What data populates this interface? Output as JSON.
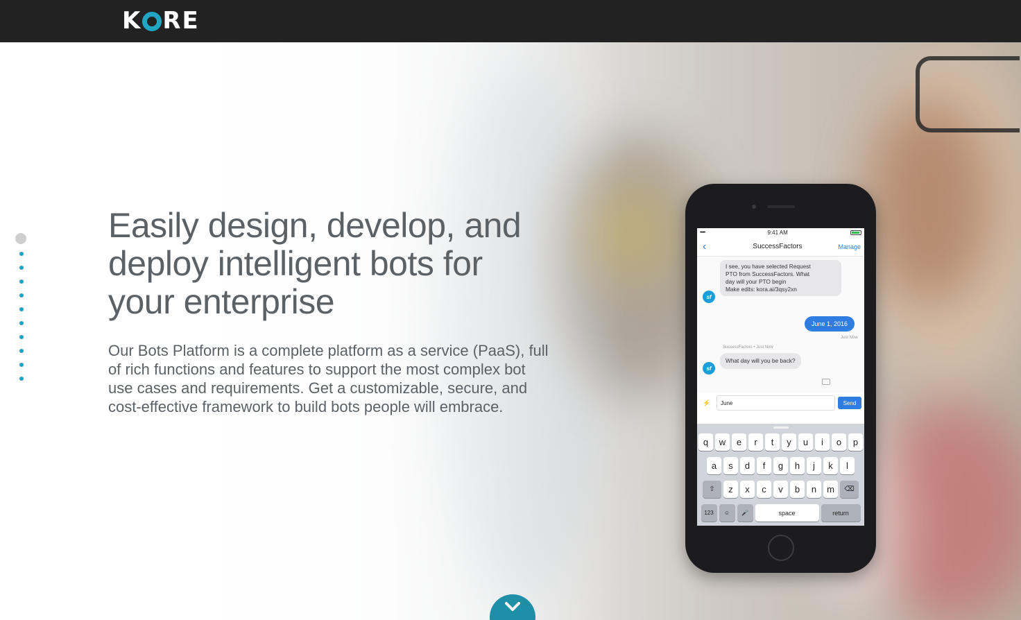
{
  "header": {
    "logo_left": "K",
    "logo_right": "RE",
    "logo_alt": "KORE"
  },
  "hero": {
    "headline": "Easily design, develop, and deploy intelligent bots for your enterprise",
    "body": "Our Bots Platform is a complete platform as a service (PaaS), full of rich functions and features to support the most complex bot use cases and requirements. Get a customizable, secure, and cost-effective framework to build bots people will embrace."
  },
  "slides": {
    "count": 11,
    "active_index": 0,
    "active_color": "#cfcfcf",
    "dot_color": "#1ea3c3"
  },
  "phone": {
    "status_bar": {
      "signal": "•••••",
      "time": "9:41 AM"
    },
    "nav": {
      "back_icon": "chevron-left-icon",
      "title": "SuccessFactors",
      "action": "Manage"
    },
    "messages": [
      {
        "from": "bot",
        "avatar": "sf",
        "lines": [
          "I see, you have selected Request",
          "PTO from SuccessFactors. What",
          "day will your PTO begin",
          " Make edits: kora.ai/3qsy2xn"
        ]
      },
      {
        "from": "user",
        "text": "June 1, 2016",
        "meta": "Just Now"
      },
      {
        "from": "bot",
        "avatar": "sf",
        "meta": "SuccessFactors • Just Now",
        "text": "What day will you be back?"
      }
    ],
    "composer": {
      "value": "June",
      "send_label": "Send"
    },
    "keyboard": {
      "row1": [
        "q",
        "w",
        "e",
        "r",
        "t",
        "y",
        "u",
        "i",
        "o",
        "p"
      ],
      "row2": [
        "a",
        "s",
        "d",
        "f",
        "g",
        "h",
        "j",
        "k",
        "l"
      ],
      "row3": [
        "z",
        "x",
        "c",
        "v",
        "b",
        "n",
        "m"
      ],
      "numbers_label": "123",
      "space_label": "space",
      "return_label": "return"
    }
  },
  "scroll_button": {
    "icon": "chevron-down-icon"
  },
  "colors": {
    "accent": "#1e8fa6",
    "header_bg": "#222222",
    "text": "#5c6166",
    "ios_blue": "#2f7de1"
  }
}
